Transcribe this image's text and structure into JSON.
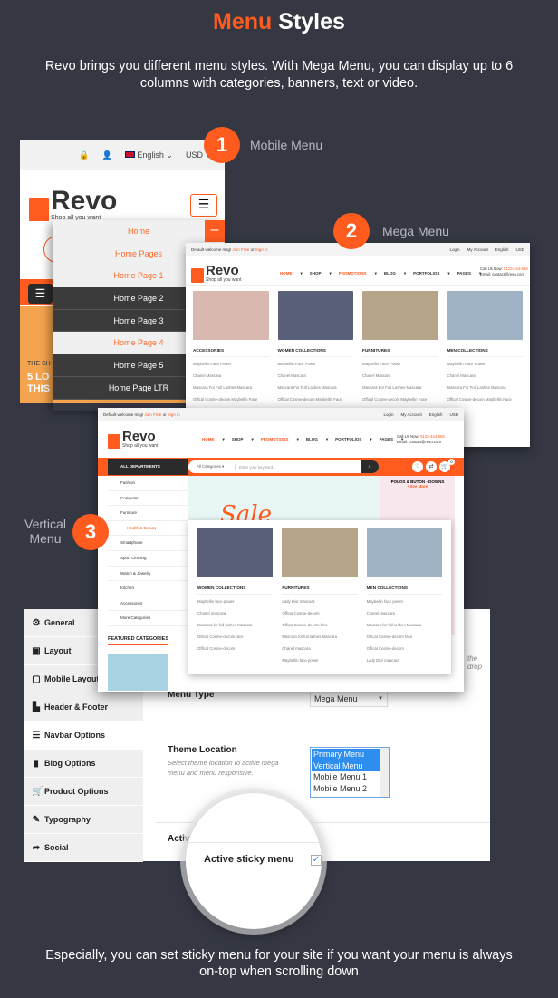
{
  "title": {
    "highlight": "Menu",
    "rest": "Styles"
  },
  "description": "Revo brings you different menu styles. With Mega Menu, you can display up to 6 columns with categories, banners, text or video.",
  "colors": {
    "background": "#353843",
    "accent": "#ff5b1f",
    "selection": "#2e8ef0"
  },
  "badges": [
    {
      "number": "1",
      "label": "Mobile Menu"
    },
    {
      "number": "2",
      "label": "Mega Menu"
    },
    {
      "number": "3",
      "label": "Vertical Menu"
    }
  ],
  "logo": {
    "name": "Revo",
    "tagline": "Shop all you want"
  },
  "mobile": {
    "language": "English",
    "currency": "USD",
    "menu": [
      {
        "label": "Home",
        "style": "light"
      },
      {
        "label": "Home Pages",
        "style": "light"
      },
      {
        "label": "Home Page 1",
        "style": "light"
      },
      {
        "label": "Home Page 2",
        "style": "dark"
      },
      {
        "label": "Home Page 3",
        "style": "dark"
      },
      {
        "label": "Home Page 4",
        "style": "light"
      },
      {
        "label": "Home Page 5",
        "style": "dark"
      },
      {
        "label": "Home Page LTR",
        "style": "dark"
      }
    ],
    "banner_small": "THE SH",
    "banner_big": "5 LO\nTHIS"
  },
  "topbar": {
    "welcome": "Default welcome msg!",
    "join": "Join Free",
    "or": "or",
    "signin": "Sign in",
    "login": "Login",
    "account": "My Account",
    "language": "English",
    "currency": "USD"
  },
  "nav": [
    "HOME",
    "SHOP",
    "PROMOTIONS",
    "BLOG",
    "PORTFOLIOS",
    "PAGES"
  ],
  "nav_tags": {
    "shop": "New",
    "promotions": "Hot"
  },
  "call": {
    "label": "Call Us Now:",
    "phone": "0123-444-666",
    "email": "Email: contact@revo.com"
  },
  "mega": {
    "columns": [
      {
        "title": "ACCESSORIES",
        "items": [
          "Maybellin Face Power",
          "Chanel Mascara",
          "Mascara For Full Lashes Mascara",
          "Offical Cosme-decom Maybellin Face"
        ]
      },
      {
        "title": "WOMEN COLLECTIONS",
        "items": [
          "Maybellin Face Power",
          "Chanel Mascara",
          "Mascara For Full Lashes Mascara",
          "Offical Cosme-decom Maybellin Face"
        ]
      },
      {
        "title": "FURNITURES",
        "items": [
          "Maybellin Face Power",
          "Chanel Mascara",
          "Mascara For Full Lashes Mascara",
          "Offical Cosme-decom Maybellin Face"
        ]
      },
      {
        "title": "MEN COLLECTIONS",
        "items": [
          "Maybellin Face Power",
          "Chanel Mascara",
          "Mascara For Full Lashes Mascara",
          "Offical Cosme-decom Maybellin Face"
        ]
      }
    ]
  },
  "vertical": {
    "all_departments": "ALL DEPARTMENTS",
    "category_select": "All Categories",
    "search_placeholder": "Enter your keyword...",
    "cart_count": "0",
    "categories": [
      "Fashion",
      "Computer",
      "Furniture",
      "Health & Beauty",
      "Smartphone",
      "Sport Clothing",
      "Watch & Jewelry",
      "Kitchen",
      "Accessories",
      "More Categories"
    ],
    "active_category": "Health & Beauty",
    "sale": "Sale",
    "promo_title": "POLOS & BUTON - DOWNS",
    "promo_link": "• See More",
    "featured": "FEATURED CATEGORIES",
    "columns": [
      {
        "title": "WOMEN COLLECTIONS",
        "items": [
          "Maybellin face power",
          "Chanel mascara",
          "Mascara for full lashes Mascara",
          "Offical Cosme-decom face",
          "Offical Cosme-decom"
        ]
      },
      {
        "title": "FURNITURES",
        "items": [
          "Lady Dior mascara",
          "Offical Cosme-decom",
          "Offical Cosme-decom face",
          "Mascara for full lashes Mascara",
          "Chanel mascara",
          "Maybellin face power"
        ]
      },
      {
        "title": "MEN COLLECTIONS",
        "items": [
          "Maybellin face power",
          "Chanel mascara",
          "Mascara for full lashes Mascara",
          "Offical Cosme-decom face",
          "Offical Cosme-decom",
          "Lady Dior mascara"
        ]
      }
    ]
  },
  "admin": {
    "sidebar": [
      {
        "label": "General",
        "icon": "⚙"
      },
      {
        "label": "Layout",
        "icon": "▣"
      },
      {
        "label": "Mobile Layout",
        "icon": "▢"
      },
      {
        "label": "Header & Footer",
        "icon": "▙"
      },
      {
        "label": "Navbar Options",
        "icon": "☰"
      },
      {
        "label": "Blog Options",
        "icon": "▮"
      },
      {
        "label": "Product Options",
        "icon": "🛒"
      },
      {
        "label": "Typography",
        "icon": "✎"
      },
      {
        "label": "Social",
        "icon": "➦"
      }
    ],
    "active": "Navbar Options",
    "menu_type_label": "Menu Type",
    "menu_type_value": "Mega Menu",
    "theme_location_label": "Theme Location",
    "theme_location_help": "Select theme location to active mega menu and menu responsive.",
    "theme_location_options": [
      {
        "label": "Primary Menu",
        "selected": true
      },
      {
        "label": "Vertical Menu",
        "selected": true
      },
      {
        "label": "Mobile Menu 1",
        "selected": false
      },
      {
        "label": "Mobile Menu 2",
        "selected": false
      }
    ],
    "active_fragment": "Active",
    "dropdown_fragment": "the drop",
    "sticky_label": "Active sticky menu",
    "sticky_checked": true
  },
  "bottom_text": "Especially, you can set sticky menu for your site if you want your menu is always on-top when scrolling down"
}
